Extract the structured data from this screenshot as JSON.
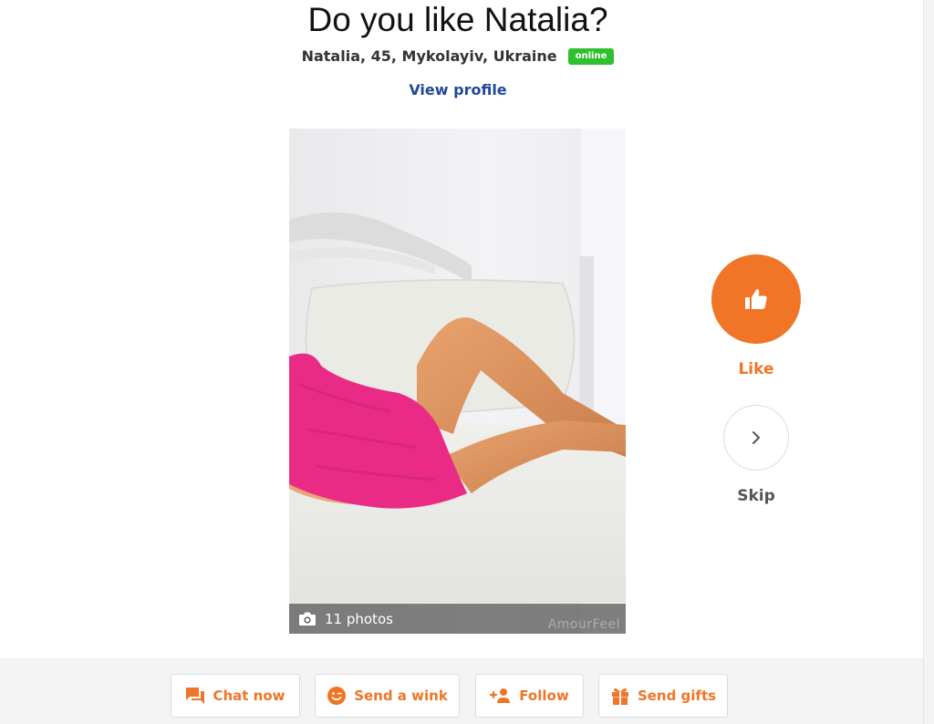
{
  "header": {
    "title": "Do you like Natalia?",
    "info": "Natalia, 45, Mykolayiv, Ukraine",
    "status_badge": "online",
    "view_profile": "View profile"
  },
  "photo": {
    "count_label": "11 photos",
    "watermark": "AmourFeel",
    "icon": "camera-icon"
  },
  "actions": {
    "like_label": "Like",
    "skip_label": "Skip",
    "like_icon": "thumbs-up-icon",
    "skip_icon": "chevron-right-icon"
  },
  "bottom_bar": {
    "chat": "Chat now",
    "wink": "Send a wink",
    "follow": "Follow",
    "gifts": "Send gifts"
  },
  "colors": {
    "accent": "#f07526",
    "online": "#2fbf2f",
    "link": "#22489a"
  }
}
